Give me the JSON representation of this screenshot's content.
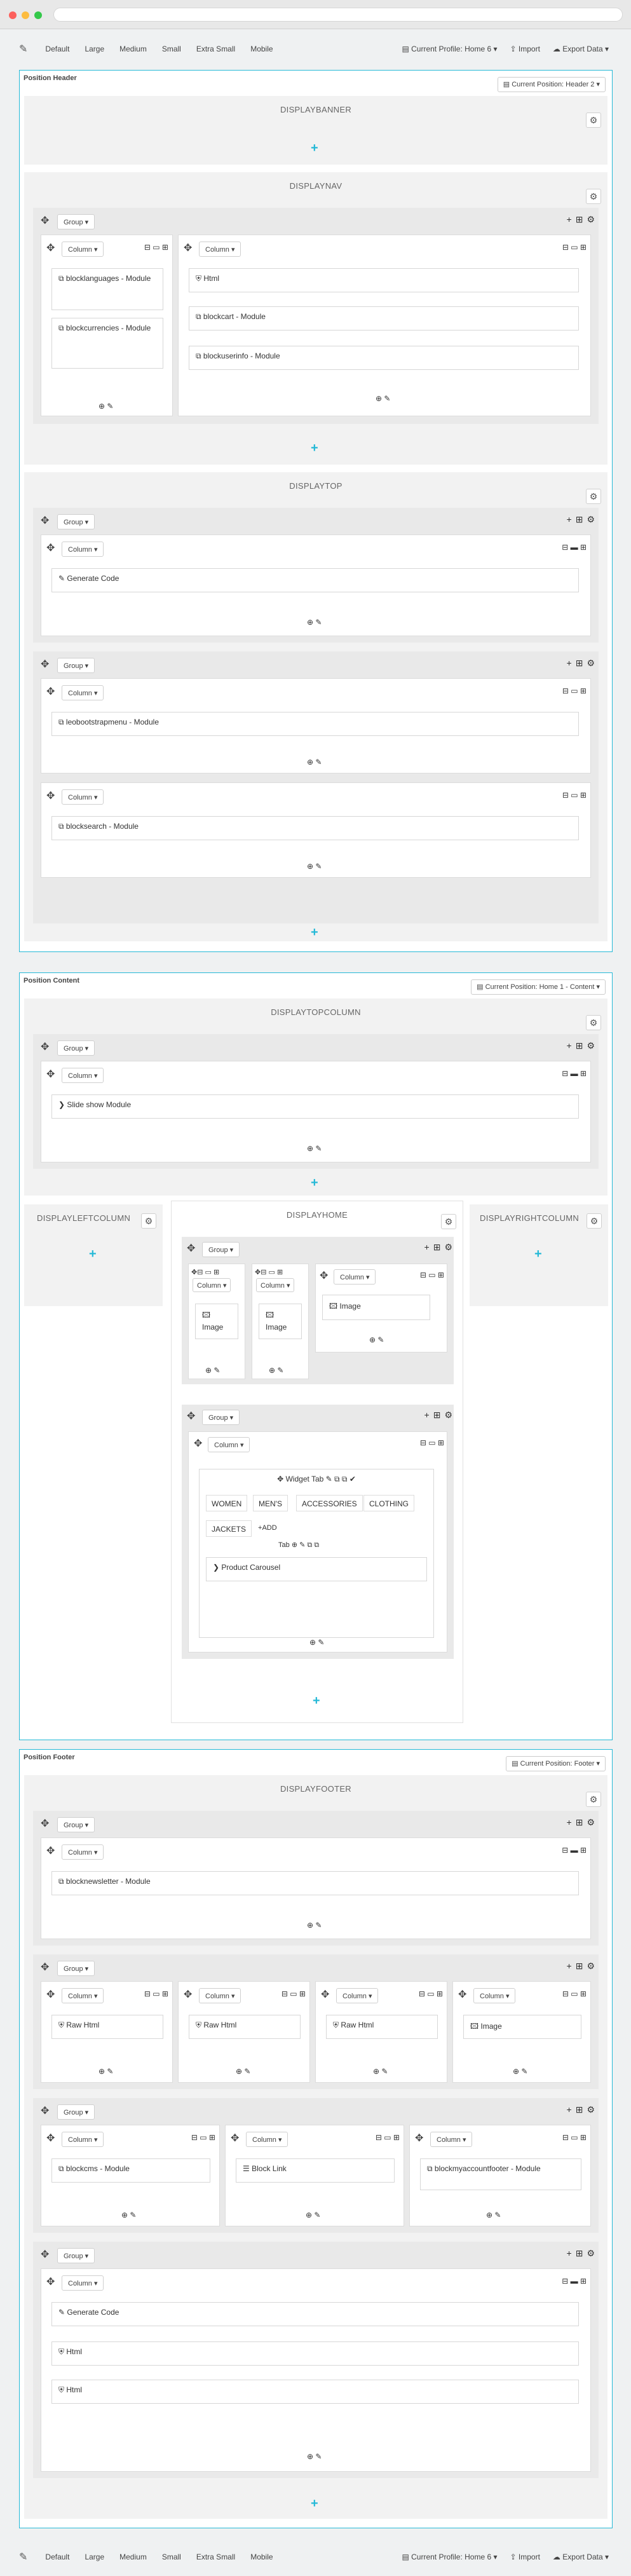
{
  "toolbar": {
    "items": [
      "Default",
      "Large",
      "Medium",
      "Small",
      "Extra Small",
      "Mobile"
    ],
    "profile": "Current Profile: Home 6",
    "import": "Import",
    "export": "Export Data"
  },
  "header": {
    "title": "Position Header",
    "select": "Current Position: Header 2",
    "banner": "DISPLAYBANNER",
    "nav": "DISPLAYNAV",
    "top": "DISPLAYTOP"
  },
  "content": {
    "title": "Position Content",
    "select": "Current Position: Home 1 - Content",
    "topcol": "DISPLAYTOPCOLUMN",
    "left": "DISPLAYLEFTCOLUMN",
    "home": "DISPLAYHOME",
    "right": "DISPLAYRIGHTCOLUMN"
  },
  "footer": {
    "title": "Position Footer",
    "select": "Current Position: Footer",
    "display": "DISPLAYFOOTER"
  },
  "labels": {
    "group": "Group",
    "column": "Column"
  },
  "widgets": {
    "languages": "blocklanguages - Module",
    "currencies": "blockcurrencies - Module",
    "html": "Html",
    "cart": "blockcart - Module",
    "userinfo": "blockuserinfo - Module",
    "generate": "Generate Code",
    "topmenu": "leobootstrapmenu - Module",
    "search": "blocksearch - Module",
    "slideshow": "Slide show Module",
    "image": "Image",
    "widgettab": "Widget Tab",
    "tabs": [
      "WOMEN",
      "MEN'S",
      "ACCESSORIES",
      "CLOTHING",
      "JACKETS"
    ],
    "add": "ADD",
    "tab": "Tab",
    "carousel": "Product Carousel",
    "newsletter": "blocknewsletter - Module",
    "rawhtml": "Raw Html",
    "cms": "blockcms - Module",
    "blocklink": "Block Link",
    "myaccount": "blockmyaccountfooter - Module"
  }
}
